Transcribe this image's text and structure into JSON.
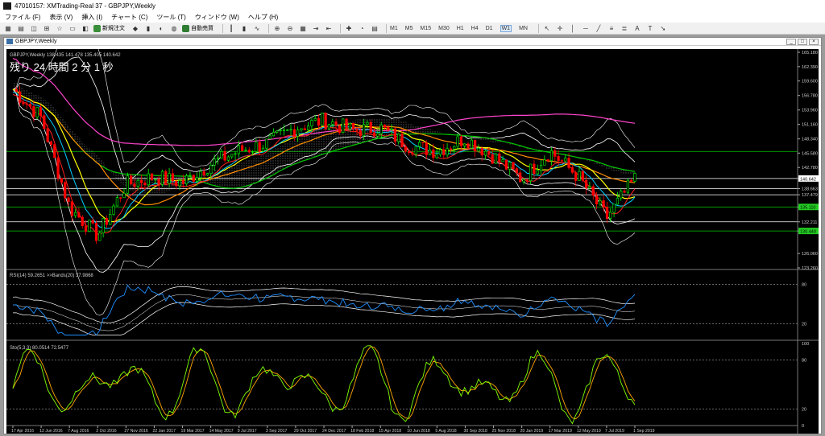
{
  "window": {
    "title": "47010157: XMTrading-Real 37 - GBPJPY,Weekly"
  },
  "menu": [
    "ファイル (F)",
    "表示 (V)",
    "挿入 (I)",
    "チャート (C)",
    "ツール (T)",
    "ウィンドウ (W)",
    "ヘルプ (H)"
  ],
  "toolbar": {
    "new_order": "新規注文",
    "auto_trade": "自動売買",
    "timeframes": [
      "M1",
      "M5",
      "M15",
      "M30",
      "H1",
      "H4",
      "D1",
      "W1",
      "MN"
    ],
    "active_timeframe": "W1"
  },
  "chart": {
    "tab_title": "GBPJPY,Weekly",
    "ohlc_line": "GBPJPY,Weekly  138.435 141.478 135.405 140.642",
    "countdown": "残り 24 時間 2 分 1 秒",
    "price_ticks": [
      "165.180",
      "162.390",
      "159.600",
      "156.780",
      "153.960",
      "151.160",
      "148.340",
      "145.580",
      "142.780",
      "140.642",
      "138.663",
      "137.479",
      "135.110",
      "132.211",
      "130.440",
      "126.060",
      "123.260"
    ],
    "date_ticks": [
      "17 Apr 2016",
      "12 Jun 2016",
      "7 Aug 2016",
      "2 Oct 2016",
      "27 Nov 2016",
      "22 Jan 2017",
      "19 Mar 2017",
      "14 May 2017",
      "9 Jul 2017",
      "3 Sep 2017",
      "29 Oct 2017",
      "24 Dec 2017",
      "18 Feb 2018",
      "15 Apr 2018",
      "10 Jun 2018",
      "5 Aug 2018",
      "30 Sep 2018",
      "25 Nov 2018",
      "20 Jan 2019",
      "17 Mar 2019",
      "12 May 2019",
      "7 Jul 2019",
      "1 Sep 2019"
    ],
    "rsi_label": "RSI(14) 59.2651  >>Bands(20) 37.9868",
    "rsi_ticks": [
      "80",
      "20"
    ],
    "sto_label": "Sto(5,3,3) 80.0514 72.5477",
    "sto_ticks": [
      "100",
      "80",
      "20",
      "0"
    ],
    "colors": {
      "background": "#000000",
      "bull": "#00ff00",
      "bear": "#ff0000",
      "ma_fast": "#ffff00",
      "ma_mid": "#ff8c00",
      "ma_slow": "#00cc00",
      "ma_long": "#ff44cc",
      "kijun": "#00cfff",
      "tenkan": "#ff2020",
      "bands": "#ffffff",
      "rsi": "#1e90ff",
      "sto_main": "#7fff00",
      "sto_signal": "#ffa500"
    }
  },
  "chart_data": {
    "type": "line",
    "title": "GBPJPY,Weekly",
    "series": [
      {
        "name": "GBPJPY",
        "x": [
          "17 Apr 2016",
          "12 Jun 2016",
          "7 Aug 2016",
          "2 Oct 2016",
          "27 Nov 2016",
          "22 Jan 2017",
          "19 Mar 2017",
          "14 May 2017",
          "9 Jul 2017",
          "3 Sep 2017",
          "29 Oct 2017",
          "24 Dec 2017",
          "18 Feb 2018",
          "15 Apr 2018",
          "10 Jun 2018",
          "5 Aug 2018",
          "30 Sep 2018",
          "25 Nov 2018",
          "20 Jan 2019",
          "17 Mar 2019",
          "12 May 2019",
          "7 Jul 2019",
          "1 Sep 2019"
        ],
        "values": [
          158.0,
          152.5,
          135.0,
          129.5,
          139.5,
          141.0,
          139.8,
          143.5,
          146.0,
          147.5,
          150.5,
          152.0,
          150.0,
          150.5,
          147.0,
          146.0,
          148.5,
          145.0,
          140.5,
          146.0,
          141.0,
          133.0,
          140.6
        ]
      }
    ],
    "ylim": [
      123.26,
      165.18
    ]
  }
}
